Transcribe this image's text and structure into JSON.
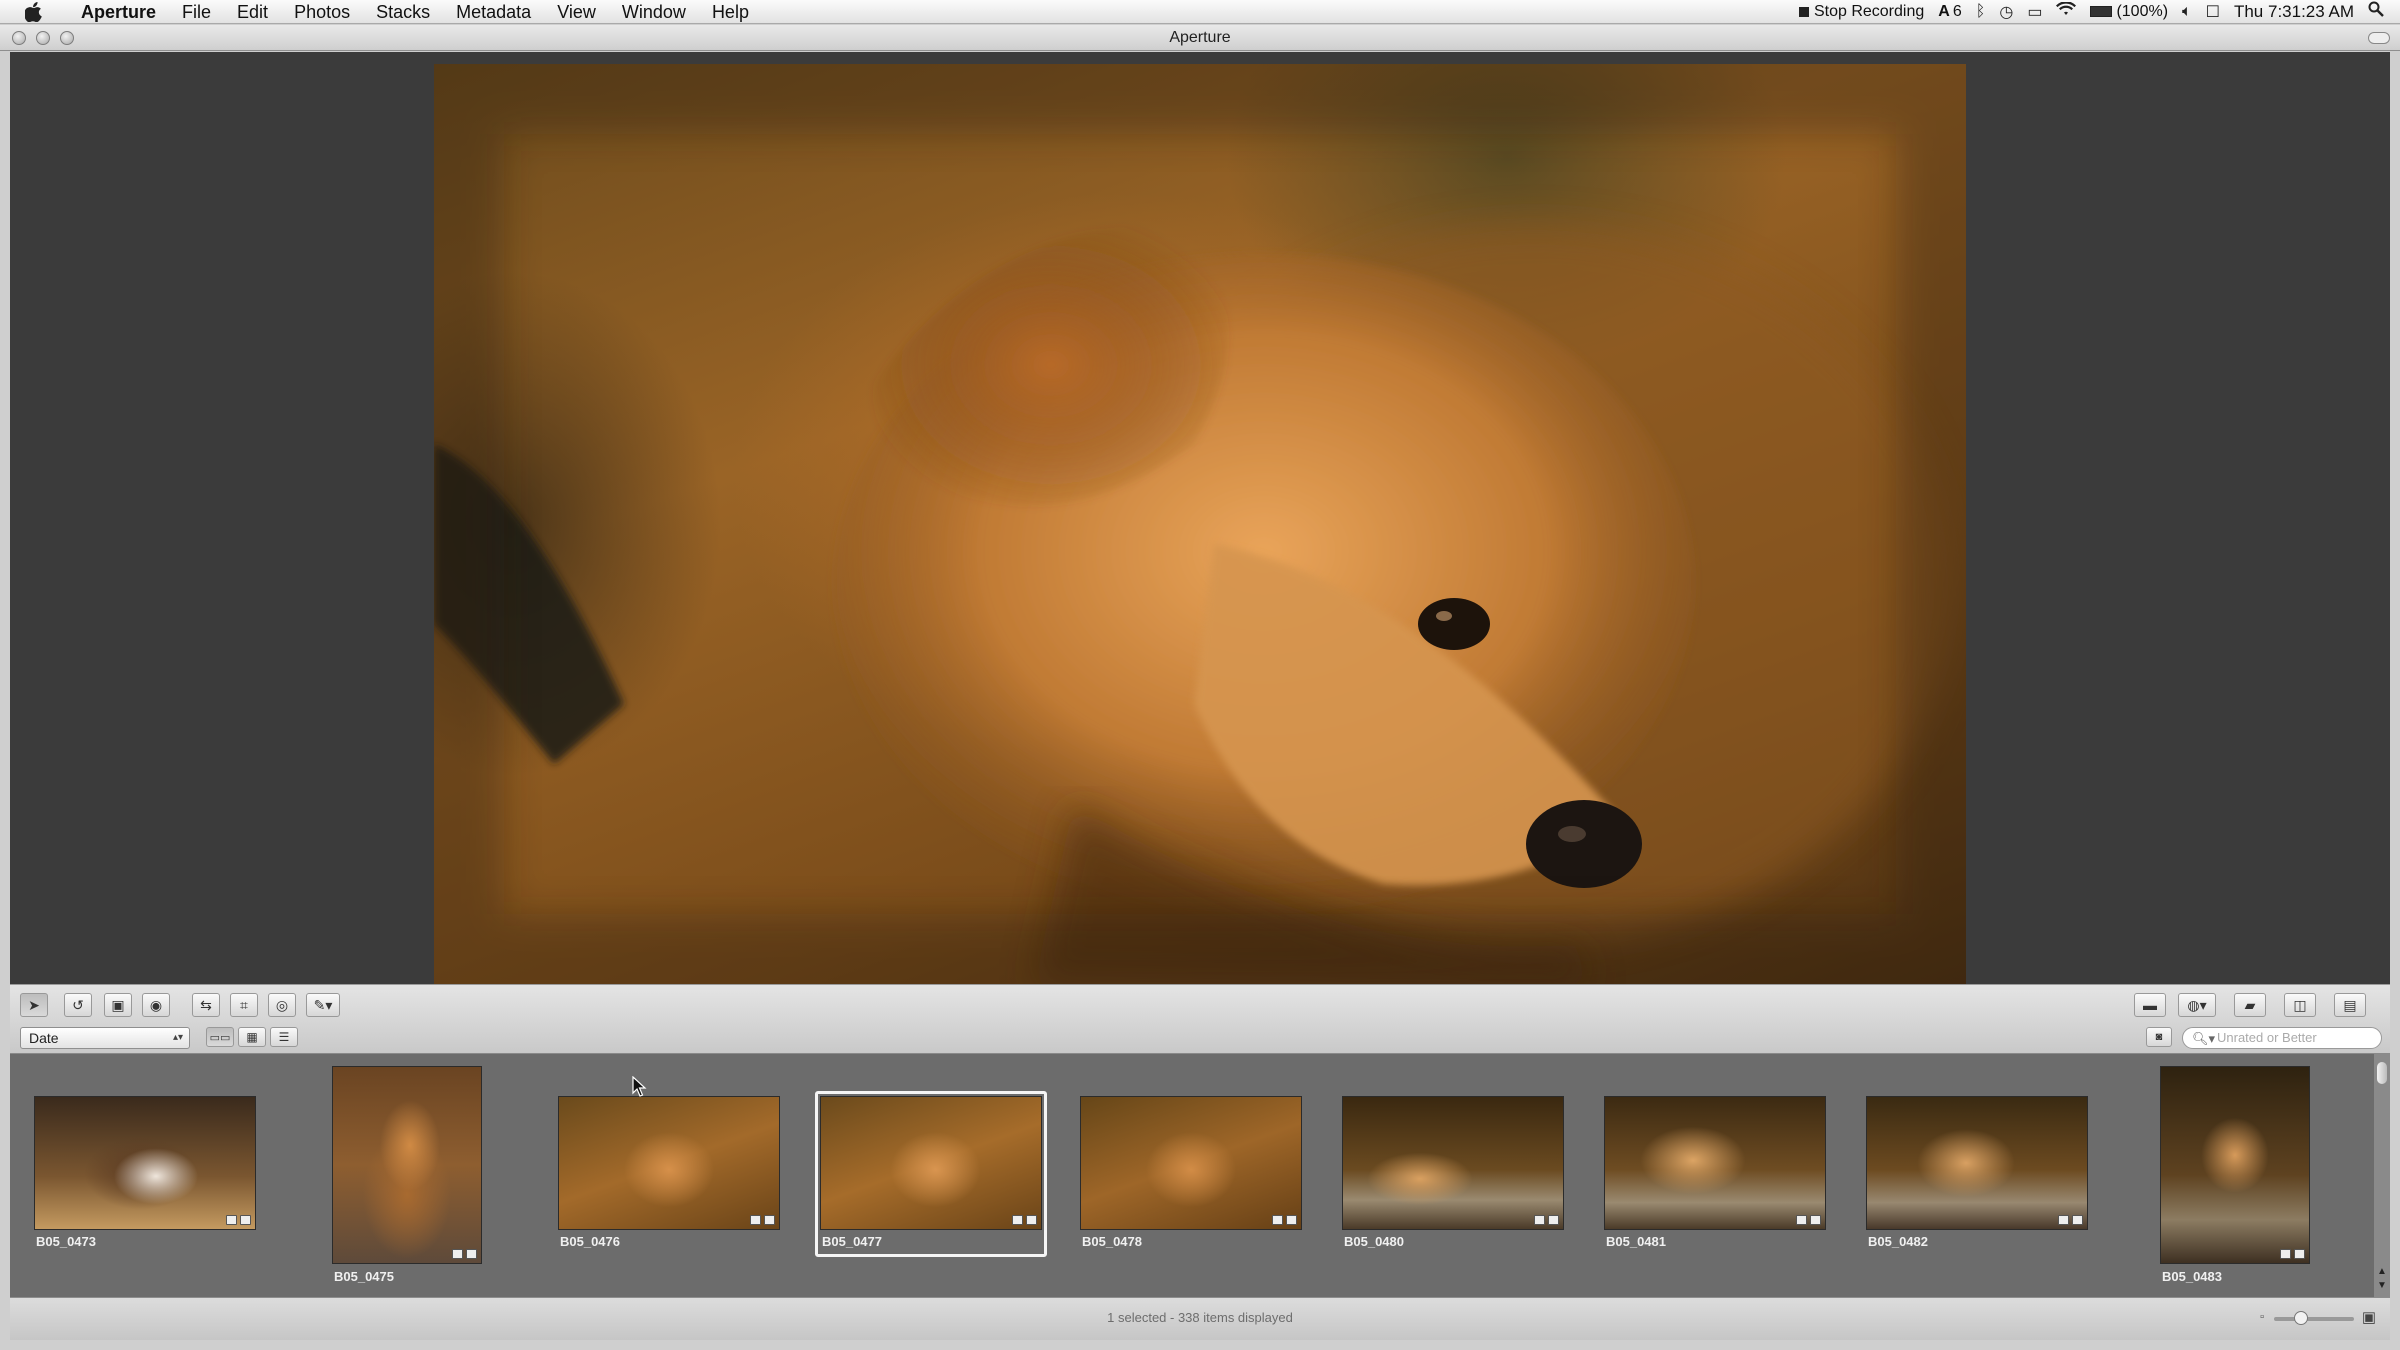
{
  "menubar": {
    "items": [
      "Aperture",
      "File",
      "Edit",
      "Photos",
      "Stacks",
      "Metadata",
      "View",
      "Window",
      "Help"
    ],
    "status": {
      "recording": "Stop Recording",
      "adobe_count": "6",
      "battery": "(100%)",
      "clock": "Thu 7:31:23 AM"
    }
  },
  "window": {
    "title": "Aperture"
  },
  "toolbar": {
    "sort_value": "Date",
    "filter_placeholder": "Unrated or Better"
  },
  "filmstrip": {
    "thumbnails": [
      {
        "label": "B05_0473",
        "subject": "cat"
      },
      {
        "label": "B05_0475",
        "subject": "dog-sitting"
      },
      {
        "label": "B05_0476",
        "subject": "dog-head"
      },
      {
        "label": "B05_0477",
        "subject": "dog-head",
        "selected": true
      },
      {
        "label": "B05_0478",
        "subject": "dog-head"
      },
      {
        "label": "B05_0480",
        "subject": "dog-lying"
      },
      {
        "label": "B05_0481",
        "subject": "dog-lying"
      },
      {
        "label": "B05_0482",
        "subject": "dog-lying"
      },
      {
        "label": "B05_0483",
        "subject": "dog-front"
      }
    ]
  },
  "statusbar": {
    "text": "1 selected - 338 items displayed"
  },
  "colors": {
    "viewer_bg": "#3b3b3b",
    "filmstrip_bg": "#6c6c6c",
    "selection": "#f5f5f5"
  }
}
